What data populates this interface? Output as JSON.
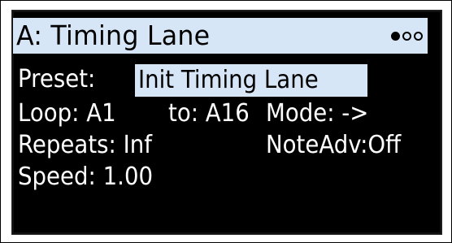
{
  "header": {
    "title": "A: Timing Lane",
    "page_indicator": {
      "total": 3,
      "active": 1
    }
  },
  "preset": {
    "label": "Preset:",
    "value": "Init Timing Lane"
  },
  "loop": {
    "label": "Loop:",
    "start": "A1",
    "to_label": "to:",
    "end": "A16"
  },
  "mode": {
    "label": "Mode:",
    "value": "->"
  },
  "repeats": {
    "label": "Repeats:",
    "value": "Inf"
  },
  "note_adv": {
    "label": "NoteAdv:",
    "value": "Off"
  },
  "speed": {
    "label": "Speed:",
    "value": "1.00"
  },
  "colors": {
    "screen_bg": "#000000",
    "text": "#ffffff",
    "highlight": "#d7e6f7"
  }
}
